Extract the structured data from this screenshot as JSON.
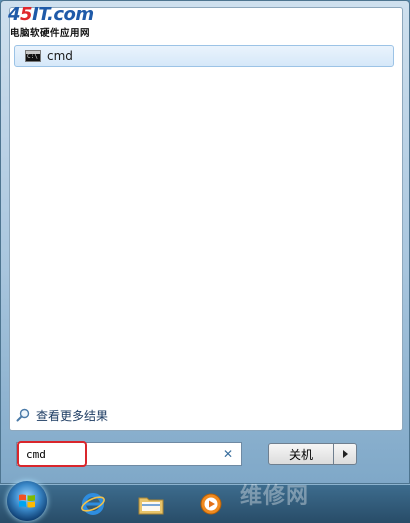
{
  "logo": {
    "main_prefix": "4",
    "main_accent": "5",
    "main_suffix": "IT.com",
    "subtitle": "电脑软硬件应用网"
  },
  "results": {
    "items": [
      {
        "label": "cmd",
        "icon": "cmd-icon"
      }
    ]
  },
  "see_more": {
    "label": "查看更多结果",
    "icon": "magnifier-icon"
  },
  "search": {
    "value": "cmd",
    "clear_icon": "close-icon"
  },
  "shutdown": {
    "label": "关机",
    "arrow_icon": "arrow-right-icon"
  },
  "taskbar": {
    "icons": [
      "windows-flag-icon",
      "ie-icon",
      "explorer-icon",
      "media-player-icon"
    ]
  },
  "watermark": {
    "text": "维修网"
  },
  "colors": {
    "highlight": "#d9262c",
    "taskbar": "#284c68",
    "result_selected": "#d6e8f9"
  }
}
